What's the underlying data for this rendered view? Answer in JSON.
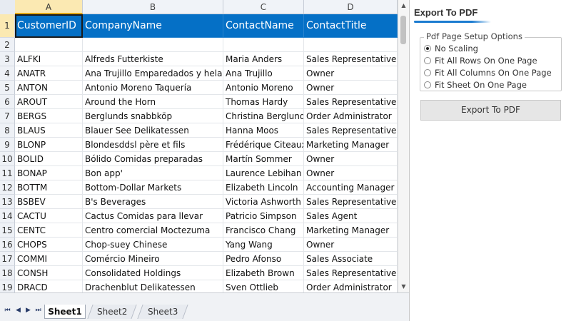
{
  "sheet": {
    "columns": [
      {
        "letter": "A",
        "label": "CustomerID"
      },
      {
        "letter": "B",
        "label": "CompanyName"
      },
      {
        "letter": "C",
        "label": "ContactName"
      },
      {
        "letter": "D",
        "label": "ContactTitle"
      }
    ],
    "header_row_number": "1",
    "blank_row_number": "2",
    "rows": [
      {
        "num": "3",
        "cells": [
          "ALFKI",
          "Alfreds Futterkiste",
          "Maria Anders",
          "Sales Representative"
        ]
      },
      {
        "num": "4",
        "cells": [
          "ANATR",
          "Ana Trujillo Emparedados y helados",
          "Ana Trujillo",
          "Owner"
        ]
      },
      {
        "num": "5",
        "cells": [
          "ANTON",
          "Antonio Moreno Taquería",
          "Antonio Moreno",
          "Owner"
        ]
      },
      {
        "num": "6",
        "cells": [
          "AROUT",
          "Around the Horn",
          "Thomas Hardy",
          "Sales Representative"
        ]
      },
      {
        "num": "7",
        "cells": [
          "BERGS",
          "Berglunds snabbköp",
          "Christina Berglund",
          "Order Administrator"
        ]
      },
      {
        "num": "8",
        "cells": [
          "BLAUS",
          "Blauer See Delikatessen",
          "Hanna Moos",
          "Sales Representative"
        ]
      },
      {
        "num": "9",
        "cells": [
          "BLONP",
          "Blondesddsl père et fils",
          "Frédérique Citeaux",
          "Marketing Manager"
        ]
      },
      {
        "num": "10",
        "cells": [
          "BOLID",
          "Bólido Comidas preparadas",
          "Martín Sommer",
          "Owner"
        ]
      },
      {
        "num": "11",
        "cells": [
          "BONAP",
          "Bon app'",
          "Laurence Lebihan",
          "Owner"
        ]
      },
      {
        "num": "12",
        "cells": [
          "BOTTM",
          "Bottom-Dollar Markets",
          "Elizabeth Lincoln",
          "Accounting Manager"
        ]
      },
      {
        "num": "13",
        "cells": [
          "BSBEV",
          "B's Beverages",
          "Victoria Ashworth",
          "Sales Representative"
        ]
      },
      {
        "num": "14",
        "cells": [
          "CACTU",
          "Cactus Comidas para llevar",
          "Patricio Simpson",
          "Sales Agent"
        ]
      },
      {
        "num": "15",
        "cells": [
          "CENTC",
          "Centro comercial Moctezuma",
          "Francisco Chang",
          "Marketing Manager"
        ]
      },
      {
        "num": "16",
        "cells": [
          "CHOPS",
          "Chop-suey Chinese",
          "Yang Wang",
          "Owner"
        ]
      },
      {
        "num": "17",
        "cells": [
          "COMMI",
          "Comércio Mineiro",
          "Pedro Afonso",
          "Sales Associate"
        ]
      },
      {
        "num": "18",
        "cells": [
          "CONSH",
          "Consolidated Holdings",
          "Elizabeth Brown",
          "Sales Representative"
        ]
      },
      {
        "num": "19",
        "cells": [
          "DRACD",
          "Drachenblut Delikatessen",
          "Sven Ottlieb",
          "Order Administrator"
        ]
      }
    ]
  },
  "tabs": [
    "Sheet1",
    "Sheet2",
    "Sheet3"
  ],
  "active_tab": "Sheet1",
  "nav_icons": [
    "first-sheet-icon",
    "prev-sheet-icon",
    "next-sheet-icon",
    "last-sheet-icon"
  ],
  "panel": {
    "title": "Export To PDF",
    "group_label": "Pdf Page Setup Options",
    "options": [
      "No Scaling",
      "Fit All Rows On One Page",
      "Fit All Columns On One Page",
      "Fit Sheet On One Page"
    ],
    "selected_option": "No Scaling",
    "button_label": "Export To PDF"
  },
  "colors": {
    "header_fill": "#0570c6",
    "header_text": "#ffffff",
    "selected_header": "#fbe9b2",
    "accent": "#1b7bd0"
  }
}
